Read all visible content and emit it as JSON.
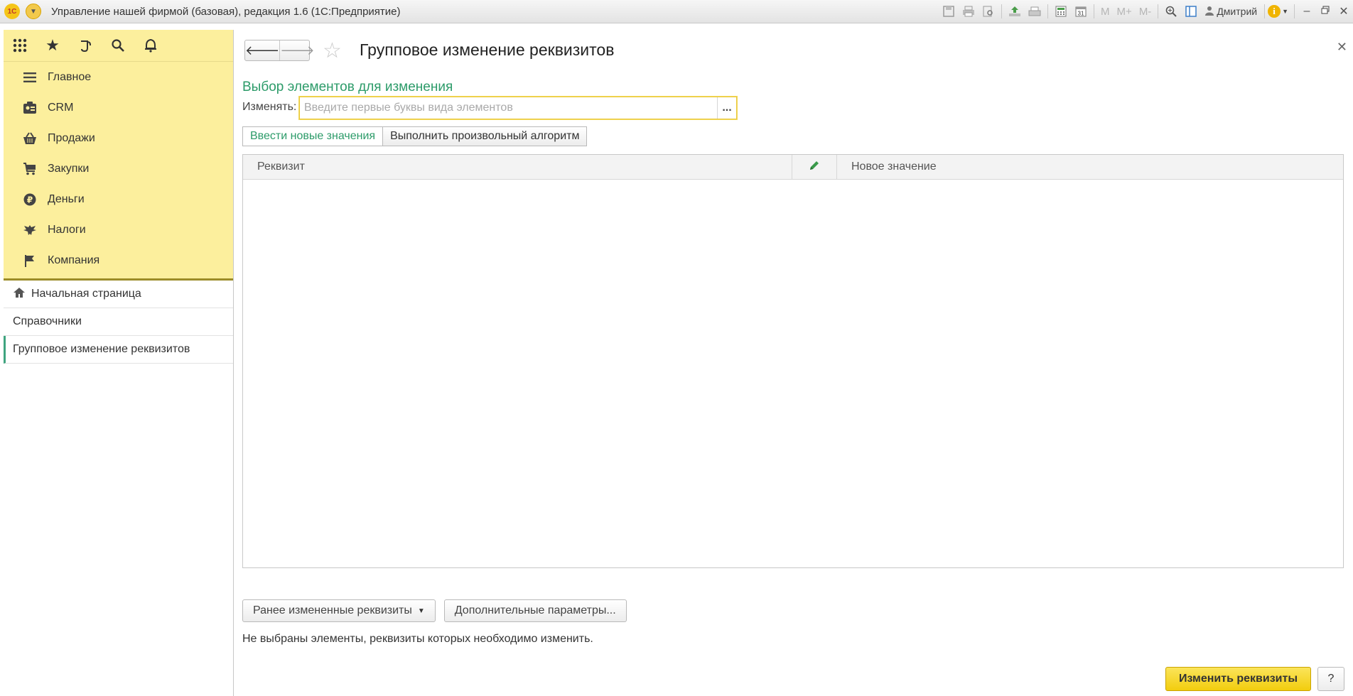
{
  "titlebar": {
    "app_title": "Управление нашей фирмой (базовая), редакция 1.6  (1С:Предприятие)",
    "logo": "1С",
    "user": "Дмитрий",
    "m_buttons": [
      "M",
      "M+",
      "M-"
    ],
    "calendar_day": "31"
  },
  "sidebar": {
    "top_icons": [
      "apps-grid-icon",
      "star-icon",
      "history-icon",
      "search-icon",
      "bell-icon"
    ],
    "sections": [
      {
        "label": "Главное",
        "icon": "menu-icon"
      },
      {
        "label": "CRM",
        "icon": "crm-icon"
      },
      {
        "label": "Продажи",
        "icon": "basket-icon"
      },
      {
        "label": "Закупки",
        "icon": "cart-icon"
      },
      {
        "label": "Деньги",
        "icon": "ruble-icon"
      },
      {
        "label": "Налоги",
        "icon": "eagle-icon"
      },
      {
        "label": "Компания",
        "icon": "flag-icon"
      }
    ],
    "open_windows": [
      {
        "label": "Начальная страница",
        "icon": "home-icon"
      },
      {
        "label": "Справочники"
      },
      {
        "label": "Групповое изменение реквизитов",
        "active": true
      }
    ]
  },
  "form": {
    "title": "Групповое изменение реквизитов",
    "section_title": "Выбор элементов для изменения",
    "change_label": "Изменять:",
    "change_placeholder": "Введите первые буквы вида элементов",
    "select_button": "...",
    "tabs": [
      {
        "label": "Ввести новые значения",
        "active": true
      },
      {
        "label": "Выполнить произвольный алгоритм",
        "active": false
      }
    ],
    "table": {
      "columns": [
        "Реквизит",
        "",
        "Новое значение"
      ],
      "rows": []
    },
    "prev_changed_button": "Ранее измененные реквизиты",
    "extra_params_button": "Дополнительные параметры...",
    "status_message": "Не выбраны элементы, реквизиты которых необходимо изменить.",
    "primary_button": "Изменить реквизиты",
    "help_button": "?"
  },
  "colors": {
    "sidebar_bg": "#fcef9d",
    "accent_green": "#2c9b69",
    "primary_yellow": "#f2cd0e"
  }
}
